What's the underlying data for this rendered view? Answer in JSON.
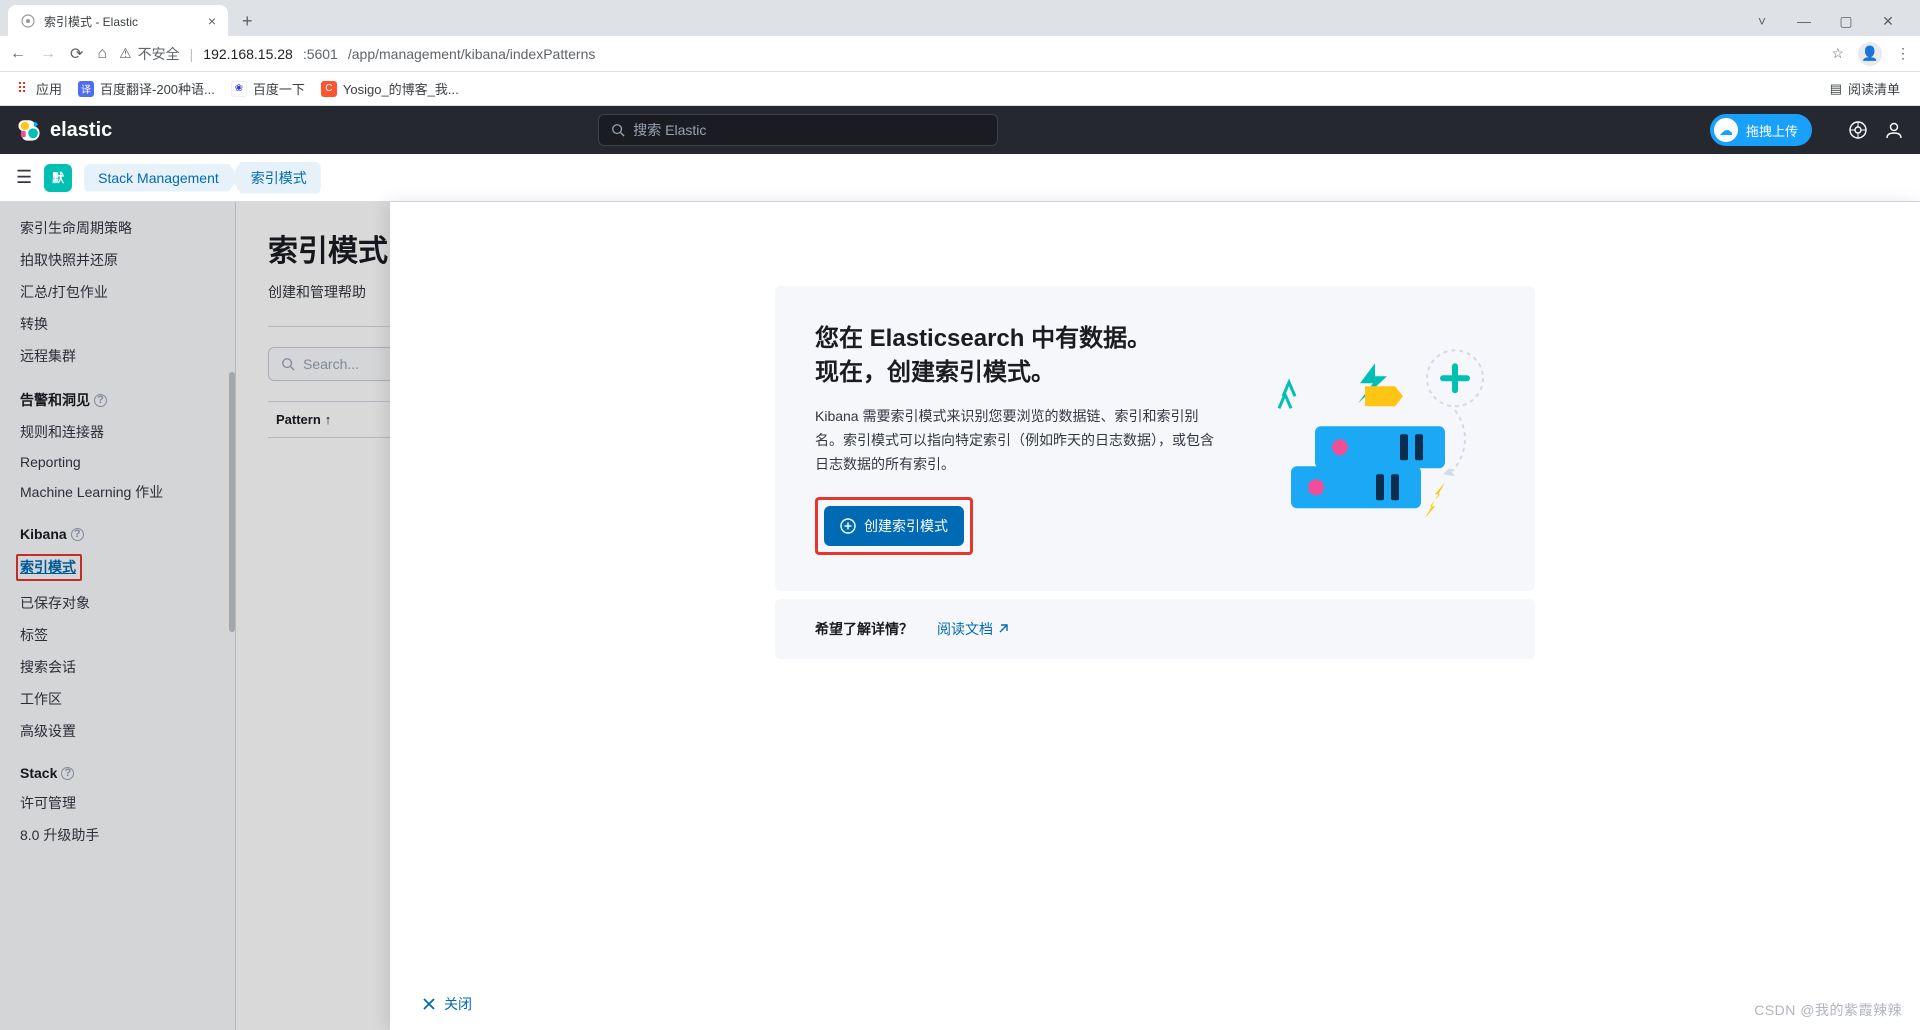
{
  "browser": {
    "tab_title": "索引模式 - Elastic",
    "not_secure": "不安全",
    "url_host": "192.168.15.28",
    "url_port": ":5601",
    "url_path": "/app/management/kibana/indexPatterns",
    "bookmarks": {
      "apps": "应用",
      "baidu_translate": "百度翻译-200种语...",
      "baidu": "百度一下",
      "yosigo": "Yosigo_的博客_我..."
    },
    "reading_list": "阅读清单"
  },
  "header": {
    "brand": "elastic",
    "search_placeholder": "搜索 Elastic",
    "upload_label": "拖拽上传"
  },
  "breadcrumb": {
    "space": "默",
    "stack_management": "Stack Management",
    "index_patterns": "索引模式"
  },
  "sidebar": {
    "items_top": [
      "索引生命周期策略",
      "拍取快照并还原",
      "汇总/打包作业",
      "转换",
      "远程集群"
    ],
    "section_alerts": "告警和洞见",
    "items_alerts": [
      "规则和连接器",
      "Reporting",
      "Machine Learning 作业"
    ],
    "section_kibana": "Kibana",
    "items_kibana": [
      "索引模式",
      "已保存对象",
      "标签",
      "搜索会话",
      "工作区",
      "高级设置"
    ],
    "section_stack": "Stack",
    "items_stack": [
      "许可管理",
      "8.0 升级助手"
    ]
  },
  "main": {
    "title": "索引模式",
    "subtitle_prefix": "创建和管理帮助",
    "search_placeholder": "Search...",
    "col_pattern": "Pattern"
  },
  "flyout": {
    "title_line1": "您在 Elasticsearch 中有数据。",
    "title_line2": "现在，创建索引模式。",
    "description": "Kibana 需要索引模式来识别您要浏览的数据链、索引和索引别名。索引模式可以指向特定索引（例如昨天的日志数据），或包含日志数据的所有索引。",
    "create_button": "创建索引模式",
    "want_more": "希望了解详情？",
    "read_docs": "阅读文档",
    "close": "关闭"
  },
  "watermark": "CSDN @我的紫霞辣辣"
}
